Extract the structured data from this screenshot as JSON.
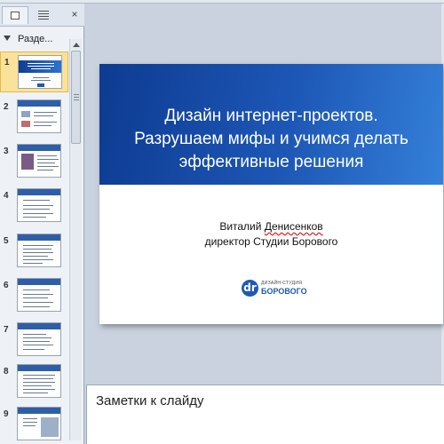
{
  "left_panel": {
    "section_label": "Разде...",
    "close_glyph": "×",
    "slides": [
      {
        "number": "1"
      },
      {
        "number": "2"
      },
      {
        "number": "3"
      },
      {
        "number": "4"
      },
      {
        "number": "5"
      },
      {
        "number": "6"
      },
      {
        "number": "7"
      },
      {
        "number": "8"
      },
      {
        "number": "9"
      }
    ],
    "selected_slide": "1"
  },
  "slide": {
    "title_lines": [
      "Дизайн интернет-проектов.",
      "Разрушаем мифы и учимся делать",
      "эффективные решения"
    ],
    "author_name": "Виталий",
    "author_surname": "Денисенков",
    "author_position": "директор Студии Борового",
    "logo_mark": "dr",
    "logo_top": "ДИЗАЙН-СТУДИЯ",
    "logo_bottom": "БОРОВОГО"
  },
  "notes": {
    "placeholder": "Заметки к слайду"
  },
  "colors": {
    "banner": "#1d57b6",
    "selection": "#fbe29a"
  }
}
